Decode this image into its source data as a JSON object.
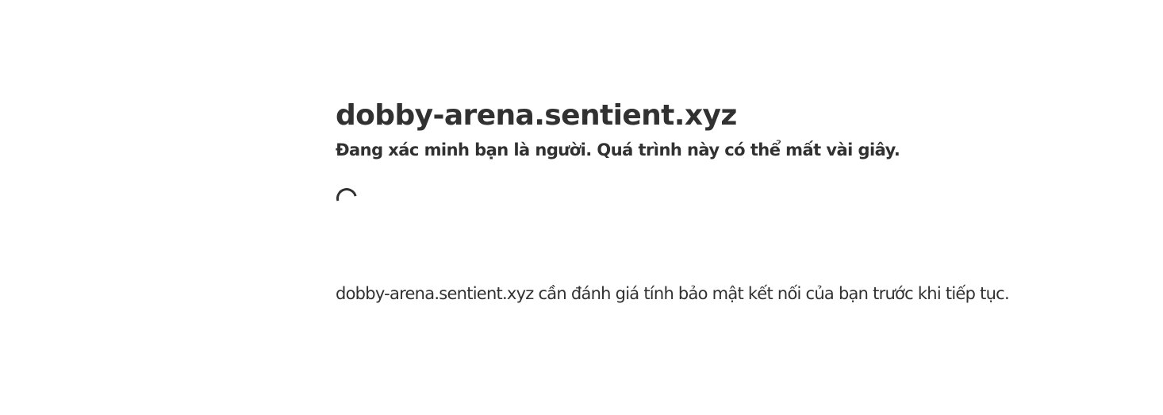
{
  "page": {
    "host": "dobby-arena.sentient.xyz",
    "verifying_text": "Đang xác minh bạn là người. Quá trình này có thể mất vài giây.",
    "security_text": "dobby-arena.sentient.xyz cần đánh giá tính bảo mật kết nối của bạn trước khi tiếp tục."
  },
  "colors": {
    "text": "#313131",
    "background": "#ffffff"
  },
  "icons": {
    "spinner": "loading-spinner-icon"
  }
}
